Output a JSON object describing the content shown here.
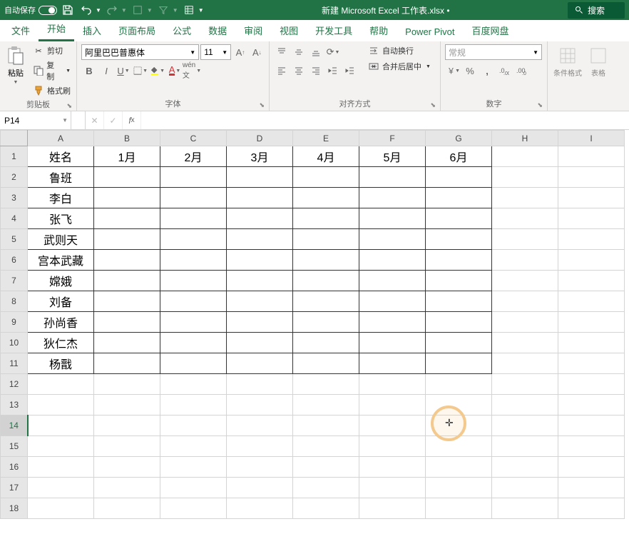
{
  "titlebar": {
    "autosave_label": "自动保存",
    "autosave_state": "关",
    "title": "新建 Microsoft Excel 工作表.xlsx  •",
    "search_label": "搜索"
  },
  "tabs": {
    "file": "文件",
    "home": "开始",
    "insert": "插入",
    "page_layout": "页面布局",
    "formulas": "公式",
    "data": "数据",
    "review": "审阅",
    "view": "视图",
    "developer": "开发工具",
    "help": "帮助",
    "power_pivot": "Power Pivot",
    "baidu": "百度网盘"
  },
  "ribbon": {
    "clipboard": {
      "paste": "粘贴",
      "cut": "剪切",
      "copy": "复制",
      "format_painter": "格式刷",
      "group_label": "剪贴板"
    },
    "font": {
      "name": "阿里巴巴普惠体",
      "size": "11",
      "group_label": "字体"
    },
    "alignment": {
      "wrap": "自动换行",
      "merge": "合并后居中",
      "group_label": "对齐方式"
    },
    "number": {
      "format": "常规",
      "group_label": "数字"
    },
    "styles": {
      "cond": "条件格式",
      "table": "表格"
    }
  },
  "formula_bar": {
    "name_box": "P14",
    "formula": ""
  },
  "grid": {
    "cols": [
      "A",
      "B",
      "C",
      "D",
      "E",
      "F",
      "G",
      "H",
      "I"
    ],
    "rows": [
      1,
      2,
      3,
      4,
      5,
      6,
      7,
      8,
      9,
      10,
      11,
      12,
      13,
      14,
      15,
      16,
      17,
      18
    ],
    "data": {
      "1": [
        "姓名",
        "1月",
        "2月",
        "3月",
        "4月",
        "5月",
        "6月"
      ],
      "2": [
        "鲁班"
      ],
      "3": [
        "李白"
      ],
      "4": [
        "张飞"
      ],
      "5": [
        "武则天"
      ],
      "6": [
        "宫本武藏"
      ],
      "7": [
        "嫦娥"
      ],
      "8": [
        "刘备"
      ],
      "9": [
        "孙尚香"
      ],
      "10": [
        "狄仁杰"
      ],
      "11": [
        "杨戬"
      ]
    },
    "data_range": {
      "rows": 11,
      "cols": 7
    },
    "selected_row": 14
  }
}
